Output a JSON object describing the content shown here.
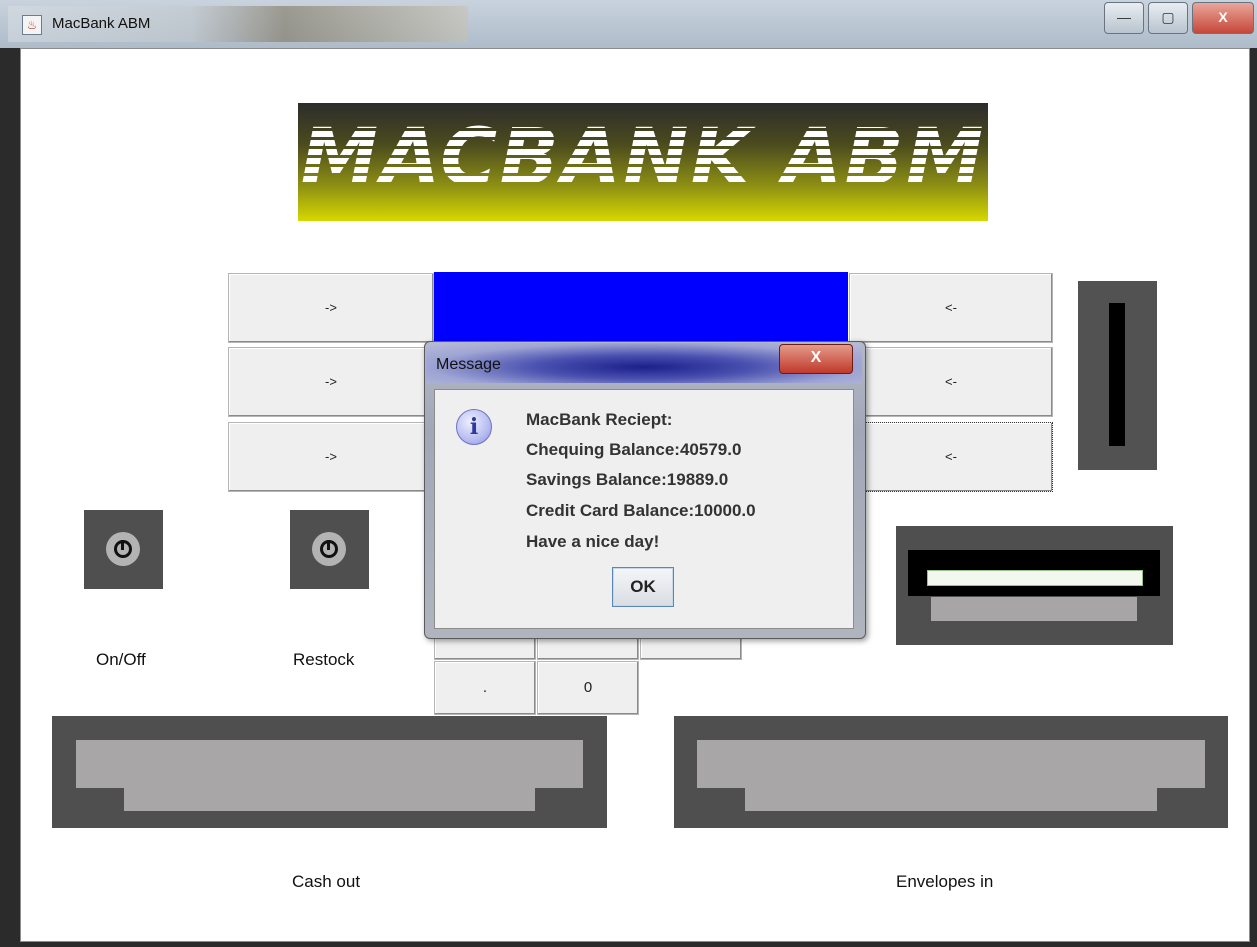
{
  "window": {
    "title": "MacBank ABM",
    "icon": "java-cup-icon",
    "controls": {
      "minimize": "—",
      "maximize": "▢",
      "close": "X"
    }
  },
  "logo": {
    "text": "MACBANK ABM"
  },
  "side_buttons": {
    "left": [
      "->",
      "->",
      "->"
    ],
    "right": [
      "<-",
      "<-",
      "<-"
    ]
  },
  "screen": {
    "color": "#0000ff"
  },
  "controls": {
    "power_label": "On/Off",
    "restock_label": "Restock"
  },
  "keypad": {
    "visible_keys": [
      ".",
      "0"
    ]
  },
  "trays": {
    "cash_label": "Cash out",
    "envelope_label": "Envelopes in"
  },
  "dialog": {
    "title": "Message",
    "close": "X",
    "icon": "info-icon",
    "icon_glyph": "i",
    "lines": [
      "MacBank Reciept:",
      "Chequing Balance:40579.0",
      "Savings Balance:19889.0",
      "Credit Card Balance:10000.0",
      "Have a nice day!"
    ],
    "ok_label": "OK"
  }
}
